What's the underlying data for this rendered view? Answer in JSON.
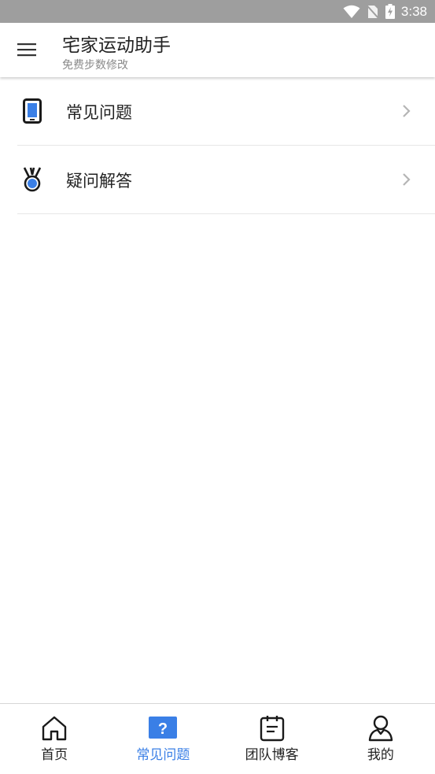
{
  "status_bar": {
    "time": "3:38",
    "icons": [
      "wifi-icon",
      "no-sim-icon",
      "battery-charging-icon"
    ]
  },
  "app_bar": {
    "title": "宅家运动助手",
    "subtitle": "免费步数修改",
    "menu_icon": "hamburger-menu-icon"
  },
  "list": {
    "items": [
      {
        "label": "常见问题",
        "icon": "phone-icon"
      },
      {
        "label": "疑问解答",
        "icon": "medal-icon"
      }
    ]
  },
  "bottom_nav": {
    "items": [
      {
        "label": "首页",
        "icon": "home-icon",
        "active": false
      },
      {
        "label": "常见问题",
        "icon": "question-icon",
        "active": true
      },
      {
        "label": "团队博客",
        "icon": "notepad-icon",
        "active": false
      },
      {
        "label": "我的",
        "icon": "user-icon",
        "active": false
      }
    ]
  },
  "colors": {
    "accent": "#3a7fe6",
    "status_bar": "#9e9e9e",
    "text": "#222222",
    "subtitle": "#8a8a8a"
  }
}
